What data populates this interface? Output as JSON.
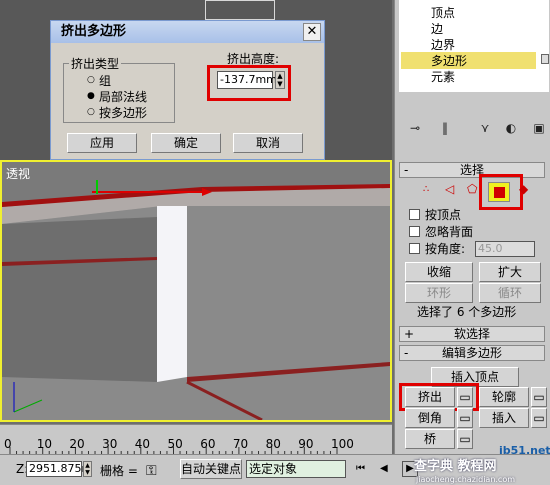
{
  "dialog": {
    "title": "挤出多边形",
    "close_symbol": "✕",
    "extrusion_type_group": "挤出类型",
    "options": [
      "组",
      "局部法线",
      "按多边形"
    ],
    "selected_option": "局部法线",
    "height_label": "挤出高度:",
    "height_value": "-137.7mm",
    "apply_label": "应用",
    "ok_label": "确定",
    "cancel_label": "取消"
  },
  "tree": {
    "items": [
      "顶点",
      "边",
      "边界",
      "多边形",
      "元素"
    ],
    "selected": "多边形"
  },
  "toolbar_icons": [
    "pin-stack-icon",
    "modifier-stack-icon",
    "remove-modifier-icon",
    "configure-icon",
    "show-end-icon"
  ],
  "selection": {
    "title": "选择",
    "by_vertex": "按顶点",
    "ignore_backfacing": "忽略背面",
    "by_angle": "按角度:",
    "angle_value": "45.0",
    "shrink": "收缩",
    "grow": "扩大",
    "ring": "环形",
    "loop": "循环",
    "status": "选择了 6 个多边形"
  },
  "soft_selection": {
    "title": "软选择"
  },
  "edit_polygons": {
    "title": "编辑多边形",
    "insert_vertex": "插入顶点",
    "extrude": "挤出",
    "outline": "轮廓",
    "bevel": "倒角",
    "inset": "插入",
    "bridge": "桥"
  },
  "viewport": {
    "label": "透视"
  },
  "timeline": {
    "ticks": [
      "0",
      "10",
      "20",
      "30",
      "40",
      "50",
      "60",
      "70",
      "80",
      "90",
      "100"
    ]
  },
  "status_bar": {
    "z_label": "Z:",
    "z_value": "2951.875m",
    "grid_label": "栅格 =",
    "auto_key": "自动关键点",
    "selected_object": "选定对象"
  },
  "watermark": {
    "site": "jb51.net",
    "subtitle": "查字典 教程网",
    "url": "jiaocheng.chazidian.com"
  },
  "colors": {
    "highlight": "#e00000",
    "selected_tree": "#f0e070",
    "viewport_border": "#f0f030"
  }
}
